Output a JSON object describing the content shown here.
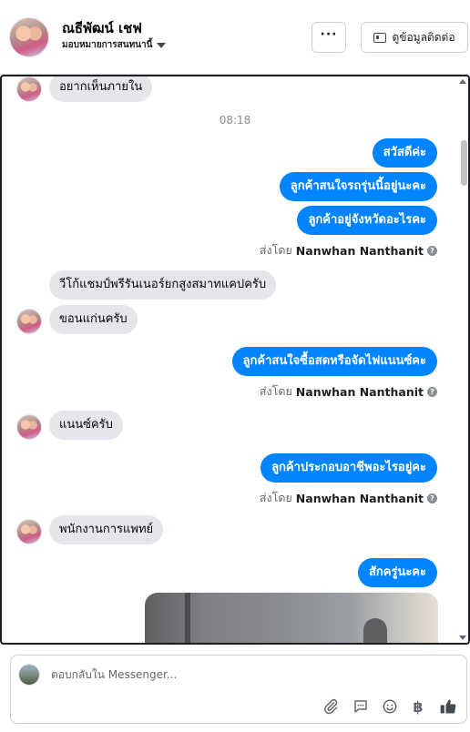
{
  "header": {
    "contact_name": "ณธีพัฒน์ เชฟ",
    "assign_label": "มอบหมายการสนทนานี้",
    "more_label": "···",
    "view_contact_label": "ดูข้อมูลติดต่อ"
  },
  "conversation": {
    "timestamp": "08:18",
    "messages": [
      {
        "dir": "in",
        "text": "อยากเห็นภายใน"
      },
      {
        "dir": "out",
        "text": "สวัสดีค่ะ"
      },
      {
        "dir": "out",
        "text": "ลูกค้าสนใจรถรุ่นนี้อยู่นะคะ"
      },
      {
        "dir": "out",
        "text": "ลูกค้าอยู่จังหวัดอะไรคะ"
      },
      {
        "dir": "in",
        "text": "วีโก้แชมป์พรีรันเนอร์ยกสูงสมาทแคปครับ"
      },
      {
        "dir": "in",
        "text": "ขอนแก่นครับ"
      },
      {
        "dir": "out",
        "text": "ลูกค้าสนใจซื้อสดหรือจัดไฟแนนซ์คะ"
      },
      {
        "dir": "in",
        "text": "แนนซ์ครับ"
      },
      {
        "dir": "out",
        "text": "ลูกค้าประกอบอาชีพอะไรอยู่คะ"
      },
      {
        "dir": "in",
        "text": "พนักงานการแพทย์"
      },
      {
        "dir": "out",
        "text": "สักครู่นะคะ"
      }
    ],
    "sent_by_prefix": "ส่งโดย",
    "sender_name": "Nanwhan Nanthanit",
    "help_glyph": "?"
  },
  "composer": {
    "placeholder": "ตอบกลับใน Messenger...",
    "icons": [
      "attachment-icon",
      "quick-reply-icon",
      "emoji-icon",
      "baht-icon",
      "like-icon"
    ],
    "baht_glyph": "฿"
  },
  "colors": {
    "outgoing_bubble": "#0084ff",
    "incoming_bubble": "#e4e6eb",
    "muted_text": "#65676b"
  }
}
